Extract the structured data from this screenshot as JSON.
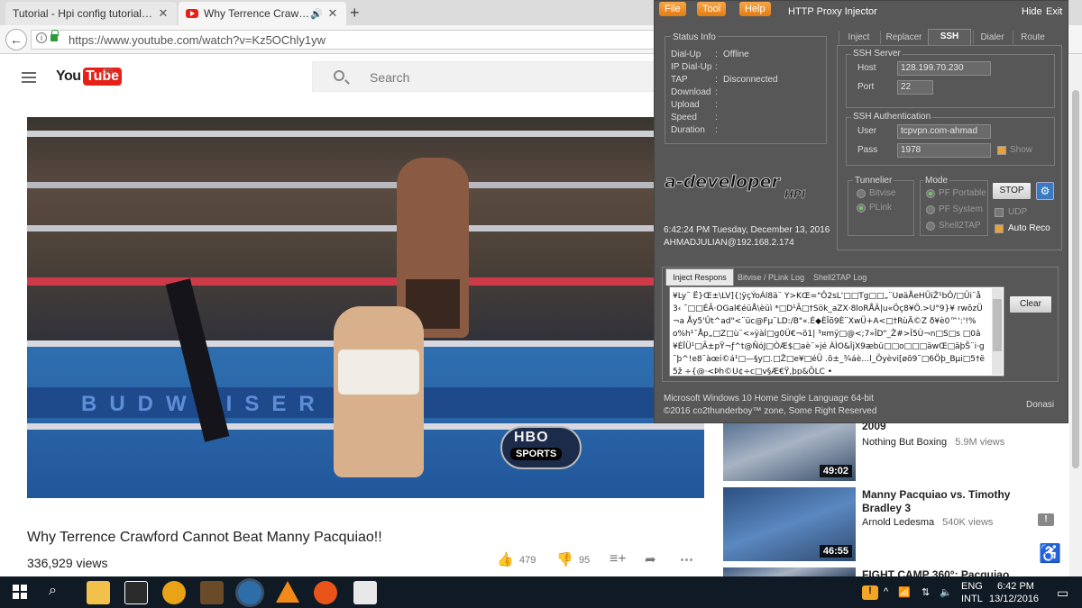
{
  "browser": {
    "tabs": [
      {
        "title": "Tutorial - Hpi config tutorial+r...",
        "close": "✕"
      },
      {
        "title": "Why Terrence Crawfor...",
        "close": "✕"
      }
    ],
    "new_tab": "+",
    "url": "https://www.youtube.com/watch?v=Kz5OChly1yw"
  },
  "youtube": {
    "logo_you": "You",
    "logo_tube": "Tube",
    "region": "SG",
    "search_placeholder": "Search",
    "video": {
      "title": "Why Terrence Crawford Cannot Beat Manny Pacquiao!!",
      "views": "336,929 views",
      "likes": "479",
      "dislikes": "95",
      "overlay_hbo": "HBO",
      "overlay_sports": "SPORTS",
      "banner_text": "BUDWEISER"
    },
    "recommendations": [
      {
        "title": "2009",
        "channel": "Nothing But Boxing",
        "views": "5.9M views",
        "duration": "49:02"
      },
      {
        "title": "Manny Pacquiao vs. Timothy Bradley 3",
        "channel": "Arnold Ledesma",
        "views": "540K views",
        "duration": "46:55"
      },
      {
        "title": "FIGHT CAMP 360°: Pacquiao",
        "channel": "",
        "views": "",
        "duration": ""
      }
    ]
  },
  "injector": {
    "menu": [
      "File",
      "Tool",
      "Help"
    ],
    "title": "HTTP Proxy Injector",
    "hide": "Hide",
    "exit": "Exit",
    "status": {
      "group_label": "Status Info",
      "rows": [
        {
          "label": "Dial-Up",
          "value": "Offline"
        },
        {
          "label": "IP Dial-Up",
          "value": ""
        },
        {
          "label": "TAP",
          "value": "Disconnected"
        },
        {
          "label": "Download",
          "value": ""
        },
        {
          "label": "Upload",
          "value": ""
        },
        {
          "label": "Speed",
          "value": ""
        },
        {
          "label": "Duration",
          "value": ""
        }
      ]
    },
    "tabs": [
      "Inject",
      "Replacer",
      "SSH",
      "Dialer",
      "Route"
    ],
    "ssh_server": {
      "group_label": "SSH Server",
      "host_label": "Host",
      "host": "128.199.70.230",
      "port_label": "Port",
      "port": "22"
    },
    "ssh_auth": {
      "group_label": "SSH Authentication",
      "user_label": "User",
      "user": "tcpvpn.com-ahmad",
      "pass_label": "Pass",
      "pass": "1978",
      "show_label": "Show"
    },
    "tunneller": {
      "group_label": "Tunnelier",
      "options": [
        "Bitvise",
        "PLink"
      ]
    },
    "mode": {
      "group_label": "Mode",
      "options": [
        "PF Portable",
        "PF System",
        "Shell2TAP"
      ]
    },
    "stop_label": "STOP",
    "udp_label": "UDP",
    "auto_reco_label": "Auto Reco",
    "logo": "a-developer HPI",
    "datetime": "6:42:24 PM   Tuesday, December 13, 2016",
    "host_id": "AHMADJULIAN@192.168.2.174",
    "log_tabs": [
      "Inject Respons",
      "Bitvise / PLink Log",
      "Shell2TAP Log"
    ],
    "log_text": "¥Ly˜ Ë}Œ±\\LV]{¦ÿçÝoÁl8ä¨ Y>KŒ=\"Ô2sL'□□Tg□□„¨UøäÅeHÜiŽ¹bÔ/□Üi¨å3‹ ˜□□ÉÃ·OGal€éüÅ\\èüì  *□D¹Ã□†Sök_aZX·8loRÅÂ|u«Öç8¥Ö.>U°9}¥ rwõzÜ¬a Åy5'Ût^ad\"<¨üc@Fµ¨LD:/B\"«.É◆ÈÏõ9È¨XwÜ+A<□†RùÄ©Z ð¥è0™':'!%o%h¹¯Åp„□Z□ù¨<»ÿàÌ□g0Ü€¬õ1| ³¤mÿ□@<;7»ÎD\"_Ž#>Î5Ù¬n□S□s  □0â¥ÈÏÜ¹□Ã±pŸ¬ƒ^t@ÑóJ□ÒÆ$□aè¨»jé ÀÌO&ÎjX9æbü□□o□□□äwŒ□äþŠ¨i·g˜þ^!e8¨àœí©á¹□—§y□.□Ž□e¥□éÜ .õ±_¾áè…l_Öyèvi[øõ9˜□6Öþ_Bµi□5†ë5ž ÷{@·<Þh©U¢÷c□v§Æ€Ÿ‚þp&ÕLC •",
    "clear_label": "Clear",
    "footer_os": "Microsoft Windows 10 Home Single Language 64-bit",
    "footer_copy": "©2016 co2thunderboy™ zone, Some Right Reserved",
    "donasi": "Donasi"
  },
  "taskbar": {
    "lang": "ENG",
    "layout": "INTL",
    "time": "6:42 PM",
    "date": "13/12/2016"
  }
}
